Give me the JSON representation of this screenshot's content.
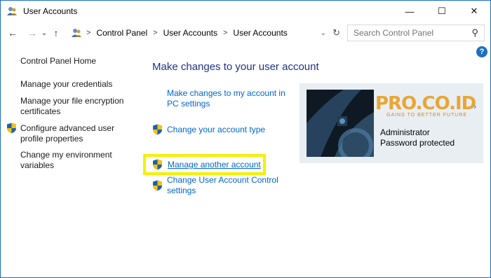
{
  "window": {
    "title": "User Accounts",
    "minimize": "—",
    "maximize": "☐",
    "close": "✕"
  },
  "nav": {
    "back": "←",
    "forward": "→",
    "recent": "⌄",
    "up": "↑",
    "breadcrumb": [
      "Control Panel",
      "User Accounts",
      "User Accounts"
    ],
    "separator": ">",
    "dropdown": "⌄",
    "refresh": "↻"
  },
  "search": {
    "placeholder": "Search Control Panel",
    "icon": "⚲"
  },
  "help": "?",
  "sidebar": {
    "home": "Control Panel Home",
    "items": [
      {
        "label_lines": [
          "Manage your credentials"
        ],
        "shield": false
      },
      {
        "label_lines": [
          "Manage your file encryption",
          "certificates"
        ],
        "shield": false
      },
      {
        "label_lines": [
          "Configure advanced user",
          "profile properties"
        ],
        "shield": true
      },
      {
        "label_lines": [
          "Change my environment",
          "variables"
        ],
        "shield": false
      }
    ]
  },
  "main": {
    "heading": "Make changes to your user account",
    "links": [
      {
        "lines": [
          "Make changes to my account in",
          "PC settings"
        ],
        "shield": false
      },
      {
        "lines": [
          "Change your account type"
        ],
        "shield": true
      },
      {
        "lines": [
          "Manage another account"
        ],
        "shield": true,
        "underline": true,
        "highlighted": true
      },
      {
        "lines": [
          "Change User Account Control",
          "settings"
        ],
        "shield": true
      }
    ]
  },
  "account": {
    "name": "Administrator",
    "status": "Password protected",
    "watermark": "PRO.CO.ID",
    "watermark_tag": "GAINS TO BETTER FUTURE"
  },
  "colors": {
    "link": "#0066cc",
    "heading": "#1e3287",
    "highlight": "#f5f000",
    "tile": "#e9eef3"
  }
}
